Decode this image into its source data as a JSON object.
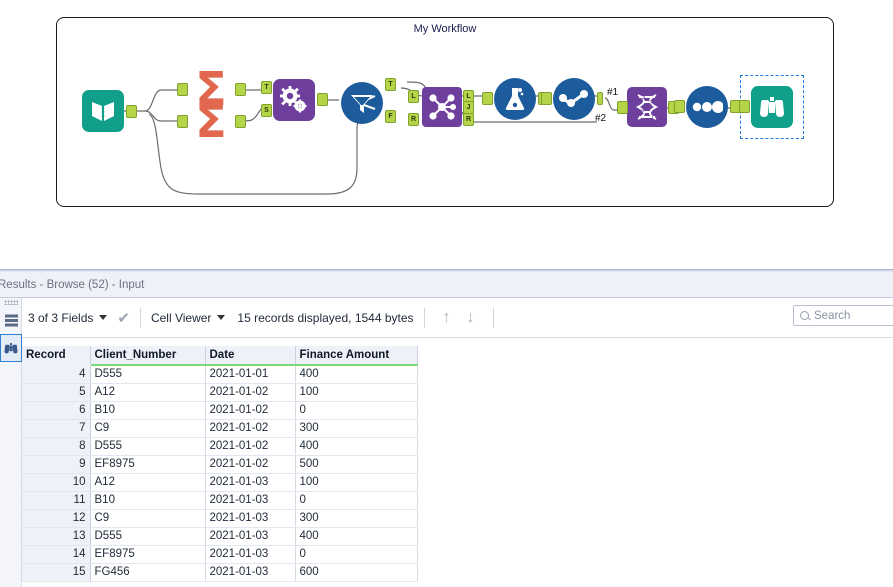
{
  "workflow": {
    "title": "My Workflow",
    "nodes": [
      {
        "id": "input-data",
        "icon": "book-icon",
        "label": "Input Data",
        "type": "teal-square"
      },
      {
        "id": "summarize-1",
        "icon": "sigma-icon",
        "label": "Summarize",
        "type": "sigma"
      },
      {
        "id": "summarize-2",
        "icon": "sigma-icon",
        "label": "Summarize",
        "type": "sigma"
      },
      {
        "id": "multi-field-formula",
        "icon": "gears-icon",
        "label": "Multi-Field Formula",
        "type": "purple-square"
      },
      {
        "id": "filter",
        "icon": "funnel-icon",
        "label": "Filter",
        "type": "blue-circle"
      },
      {
        "id": "join",
        "icon": "join-icon",
        "label": "Join",
        "type": "purple-square"
      },
      {
        "id": "formula",
        "icon": "flask-icon",
        "label": "Formula",
        "type": "blue-circle"
      },
      {
        "id": "sort",
        "icon": "sort-icon",
        "label": "Sort",
        "type": "blue-circle"
      },
      {
        "id": "transpose",
        "icon": "dna-icon",
        "label": "Transpose",
        "type": "purple-square"
      },
      {
        "id": "select",
        "icon": "dots-icon",
        "label": "Select",
        "type": "blue-circle"
      },
      {
        "id": "browse",
        "icon": "binoculars-icon",
        "label": "Browse",
        "type": "teal-square"
      }
    ],
    "connection_labels": [
      "#1",
      "#2"
    ],
    "anchors": {
      "mff_top": "T",
      "mff_bottom": "S",
      "filter_true": "T",
      "filter_false": "F",
      "join_left": "L",
      "join_join": "J",
      "join_right": "R"
    }
  },
  "results": {
    "header_title": "Results - Browse (52) - Input",
    "toolbar": {
      "fields_label": "3 of 3 Fields",
      "cell_viewer_label": "Cell Viewer",
      "records_label": "15 records displayed, 1544 bytes",
      "up_arrow": "↑",
      "down_arrow": "↓",
      "check_mark": "✔"
    },
    "search": {
      "placeholder": "Search",
      "value": ""
    },
    "rail": {
      "grid_icon": "grid-icon",
      "browse_icon": "binoculars-icon"
    },
    "columns": [
      "Record",
      "Client_Number",
      "Date",
      "Finance Amount"
    ],
    "rows": [
      [
        "4",
        "D555",
        "2021-01-01",
        "400"
      ],
      [
        "5",
        "A12",
        "2021-01-02",
        "100"
      ],
      [
        "6",
        "B10",
        "2021-01-02",
        "0"
      ],
      [
        "7",
        "C9",
        "2021-01-02",
        "300"
      ],
      [
        "8",
        "D555",
        "2021-01-02",
        "400"
      ],
      [
        "9",
        "EF8975",
        "2021-01-02",
        "500"
      ],
      [
        "10",
        "A12",
        "2021-01-03",
        "100"
      ],
      [
        "11",
        "B10",
        "2021-01-03",
        "0"
      ],
      [
        "12",
        "C9",
        "2021-01-03",
        "300"
      ],
      [
        "13",
        "D555",
        "2021-01-03",
        "400"
      ],
      [
        "14",
        "EF8975",
        "2021-01-03",
        "0"
      ],
      [
        "15",
        "FG456",
        "2021-01-03",
        "600"
      ]
    ]
  },
  "colors": {
    "teal": "#10a08a",
    "orange": "#e1684e",
    "purple": "#6f3f9e",
    "blue": "#1c5b9c",
    "anchor_green": "#b5d44a",
    "selection_blue": "#1d7ae0",
    "header_green": "#7dd87d"
  }
}
